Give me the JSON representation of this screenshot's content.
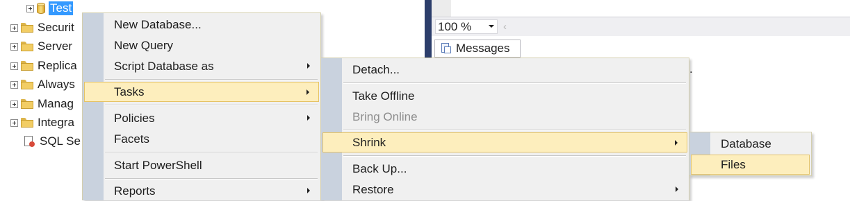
{
  "object_explorer": {
    "selected_db": "Test",
    "nodes": [
      {
        "label": "Securit",
        "icon": "folder-icon"
      },
      {
        "label": "Server",
        "icon": "folder-icon"
      },
      {
        "label": "Replica",
        "icon": "folder-icon"
      },
      {
        "label": "Always",
        "icon": "folder-icon"
      },
      {
        "label": "Manag",
        "icon": "folder-icon"
      },
      {
        "label": "Integra",
        "icon": "folder-icon"
      }
    ],
    "log_node": "SQL Se"
  },
  "query_pane": {
    "zoom_value": "100 %",
    "zoom_chevron": "‹",
    "results_tab": "Messages",
    "results_text": "."
  },
  "context_menu": {
    "items": [
      {
        "label": "New Database..."
      },
      {
        "label": "New Query"
      },
      {
        "label": "Script Database as",
        "submenu": true
      },
      {
        "label": "Tasks",
        "submenu": true,
        "highlighted": true
      },
      {
        "label": "Policies",
        "submenu": true
      },
      {
        "label": "Facets"
      },
      {
        "label": "Start PowerShell"
      },
      {
        "label": "Reports",
        "submenu": true
      }
    ]
  },
  "tasks_menu": {
    "items": [
      {
        "label": "Detach..."
      },
      {
        "label": "Take Offline"
      },
      {
        "label": "Bring Online",
        "disabled": true
      },
      {
        "label": "Shrink",
        "submenu": true,
        "highlighted": true
      },
      {
        "label": "Back Up..."
      },
      {
        "label": "Restore",
        "submenu": true
      }
    ]
  },
  "shrink_menu": {
    "items": [
      {
        "label": "Database"
      },
      {
        "label": "Files",
        "highlighted": true
      }
    ]
  },
  "colors": {
    "selection": "#3399ff",
    "menu_highlight": "#fdeebd",
    "menu_gutter": "#c9d2de",
    "splitter": "#2c3e6b"
  }
}
